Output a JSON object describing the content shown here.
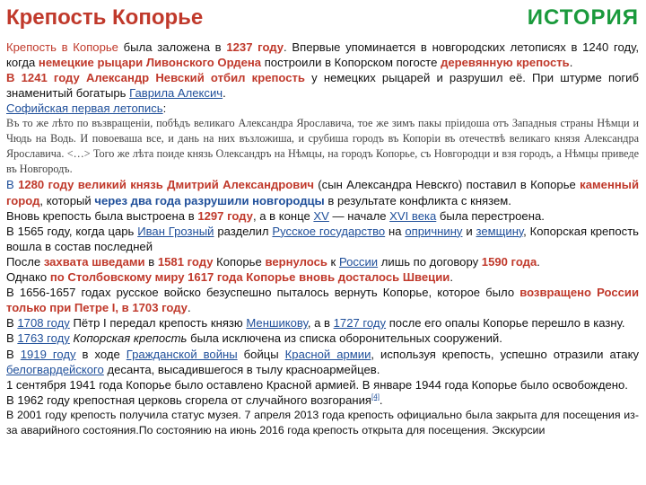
{
  "title": "Крепость Копорье",
  "section": "ИСТОРИЯ",
  "p1": {
    "a": "Крепость в Копорье",
    "b": " была заложена в ",
    "c": "1237 году",
    "d": ". Впервые упоминается в новгородских летописях в 1240 году",
    "e": ", когда ",
    "f": "немецкие рыцари Ливонского Ордена",
    "g": " построили в Копорском погосте ",
    "h": "деревянную крепость",
    "i": "."
  },
  "p2": {
    "a": "В 1241 году Александр Невский отбил крепость",
    "b": " у немецких рыцарей и разрушил её. При штурме погиб знаменитый богатырь ",
    "c": "Гаврила Алексич",
    "d": "."
  },
  "p3": {
    "a": "Софийская первая летопись",
    "b": ":"
  },
  "chronicle": "Въ то же лѣто по възвращеніи, побѣдъ великаго Александра Ярославича, тое же зимъ пакы пріидоша отъ Западныя страны Нѣмци и Чюдь на Водь. И повоеваша все, и дань на них възложиша, и срубиша городъ въ Копоріи въ отечествѣ великаго князя Александра Ярославича. <…> Того же лѣта поиде князь Олександръ на Нѣмцы, на городъ Копорье, съ Новгородци и взя городъ, а Нѣмцы приведе въ Новгородъ.",
  "p4": {
    "a": "В ",
    "b": "1280 году великий князь Дмитрий Александрович",
    "c": " (сын Александра Невскго) поставил в Копорье ",
    "d": "каменный город",
    "e": ", который ",
    "f": "через два года разрушили новгородцы",
    "g": " в результате конфликта с князем."
  },
  "p5": {
    "a": "Вновь крепость была выстроена в ",
    "b": "1297 году",
    "c": ", а в конце ",
    "d": "XV",
    "e": " — начале ",
    "f": "XVI века",
    "g": " была перестроена."
  },
  "p6": {
    "a": "В 1565 году, когда царь ",
    "b": "Иван Грозный",
    "c": " разделил ",
    "d": "Русское государство",
    "e": " на ",
    "f": "опричнину",
    "g": " и ",
    "h": "земщину",
    "i": ", Копорская крепость вошла в состав последней"
  },
  "p7": {
    "a": "После ",
    "b": "захвата шведами",
    "c": " в ",
    "d": "1581 году",
    "e": " Копорье ",
    "f": "вернулось",
    "g": " к ",
    "h": "России",
    "i": " лишь по договору ",
    "j": "1590 года",
    "k": "."
  },
  "p8": {
    "a": "Однако ",
    "b": "по Столбовскому миру 1617 года Копорье вновь досталось Швеции",
    "c": "."
  },
  "p9": {
    "a": "В 1656-1657 годах русское войско безуспешно пыталось вернуть Копорье, которое было ",
    "b": "возвращено России только при Петре I, в 1703 году",
    "c": "."
  },
  "p10": {
    "a": "В ",
    "b": "1708 году",
    "c": " Пётр I передал крепость князю ",
    "d": "Меншикову",
    "e": ", а в ",
    "f": "1727 году",
    "g": " после его опалы Копорье перешло в казну."
  },
  "p11": {
    "a": "В ",
    "b": "1763 году",
    "c": " Копорская крепость",
    "d": " была исключена из списка оборонительных сооружений."
  },
  "p12": {
    "a": "В ",
    "b": "1919 году",
    "c": " в ходе ",
    "d": "Гражданской войны",
    "e": " бойцы ",
    "f": "Красной армии",
    "g": ", используя крепость, успешно отразили атаку ",
    "h": "белогвардейского",
    "i": " десанта, высадившегося в тылу красноармейцев."
  },
  "p13": "1 сентября 1941 года Копорье было оставлено Красной армией. В январе 1944 года Копорье было освобождено.",
  "p14": {
    "a": "В 1962 году крепостная церковь сгорела от случайного возгорания",
    "b": "[4]",
    "c": "."
  },
  "p15": "В 2001 году крепость получила статус музея. 7 апреля 2013 года крепость официально была закрыта для посещения из-за аварийного состояния.По состоянию на июнь 2016 года крепость открыта для посещения. Экскурсии",
  "colors": {
    "title": "#c0392b",
    "section": "#1a9a3c",
    "link": "#1f4f9a"
  }
}
